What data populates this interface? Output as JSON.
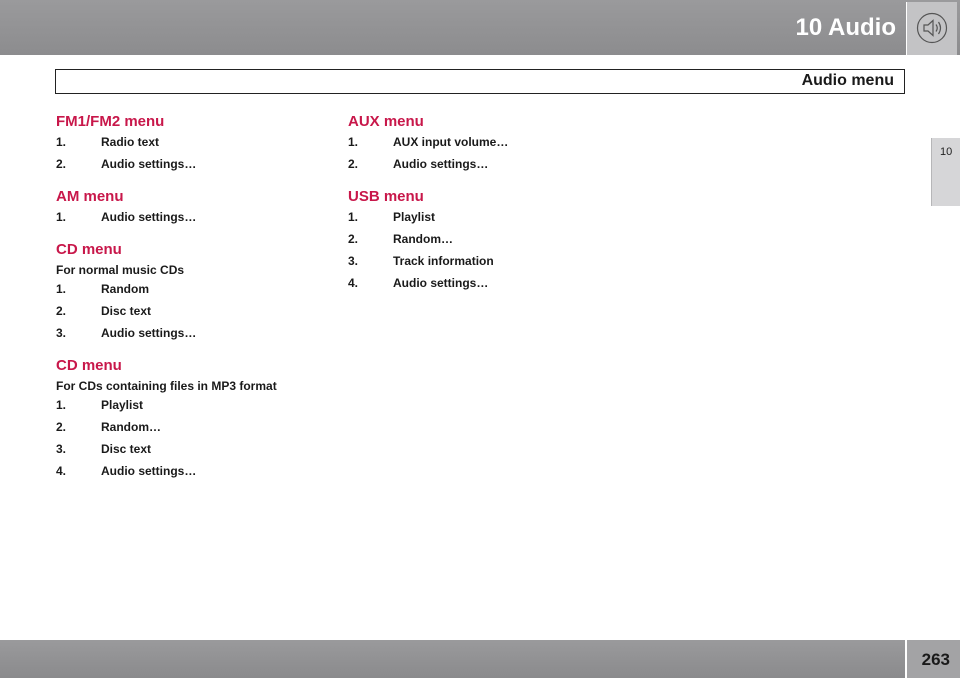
{
  "header": {
    "chapter_title": "10 Audio",
    "chapter_icon": "speaker-icon"
  },
  "section": {
    "title": "Audio menu"
  },
  "side_tab": {
    "label": "10"
  },
  "menus_left": [
    {
      "heading": "FM1/FM2 menu",
      "description": "",
      "items": [
        {
          "num": "1.",
          "label": "Radio text"
        },
        {
          "num": "2.",
          "label": "Audio settings…"
        }
      ]
    },
    {
      "heading": "AM menu",
      "description": "",
      "items": [
        {
          "num": "1.",
          "label": "Audio settings…"
        }
      ]
    },
    {
      "heading": "CD menu",
      "description": "For normal music CDs",
      "items": [
        {
          "num": "1.",
          "label": "Random"
        },
        {
          "num": "2.",
          "label": "Disc text"
        },
        {
          "num": "3.",
          "label": "Audio settings…"
        }
      ]
    },
    {
      "heading": "CD menu",
      "description": "For CDs containing files in MP3 format",
      "items": [
        {
          "num": "1.",
          "label": "Playlist"
        },
        {
          "num": "2.",
          "label": "Random…"
        },
        {
          "num": "3.",
          "label": "Disc text"
        },
        {
          "num": "4.",
          "label": "Audio settings…"
        }
      ]
    }
  ],
  "menus_right": [
    {
      "heading": "AUX menu",
      "description": "",
      "items": [
        {
          "num": "1.",
          "label": "AUX input volume…"
        },
        {
          "num": "2.",
          "label": "Audio settings…"
        }
      ]
    },
    {
      "heading": "USB menu",
      "description": "",
      "items": [
        {
          "num": "1.",
          "label": "Playlist"
        },
        {
          "num": "2.",
          "label": "Random…"
        },
        {
          "num": "3.",
          "label": "Track information"
        },
        {
          "num": "4.",
          "label": "Audio settings…"
        }
      ]
    }
  ],
  "footer": {
    "page_number": "263"
  },
  "colors": {
    "heading": "#c8174a",
    "bar": "#949496"
  }
}
